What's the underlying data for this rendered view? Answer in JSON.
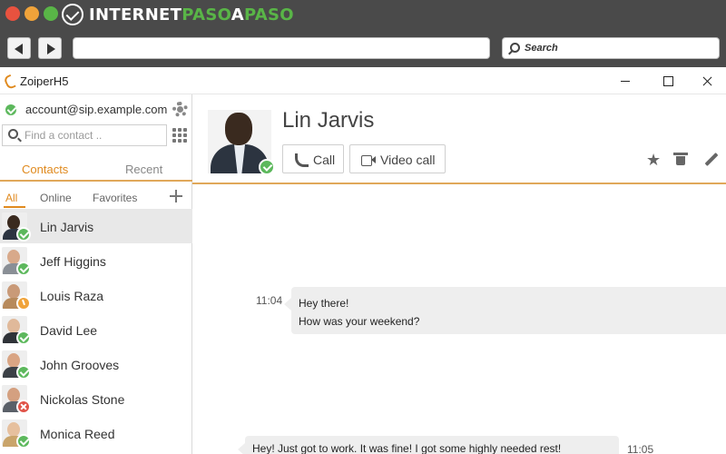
{
  "chrome": {
    "brand_part1": "INTERNET",
    "brand_part2": "PASO",
    "brand_part3": "A",
    "brand_part4": "PASO",
    "search_label": "Search",
    "traffic_colors": [
      "#e8523f",
      "#f0a33a",
      "#59b547"
    ]
  },
  "app": {
    "title": "ZoiperH5",
    "accent_color": "#e08a1e"
  },
  "sidebar": {
    "account": "account@sip.example.com",
    "find_placeholder": "Find a contact ..",
    "tabs": [
      {
        "label": "Contacts",
        "active": true
      },
      {
        "label": "Recent",
        "active": false
      }
    ],
    "filters": [
      {
        "label": "All",
        "active": true
      },
      {
        "label": "Online",
        "active": false
      },
      {
        "label": "Favorites",
        "active": false
      }
    ],
    "contacts": [
      {
        "name": "Lin Jarvis",
        "status": "online",
        "selected": true
      },
      {
        "name": "Jeff Higgins",
        "status": "online",
        "selected": false
      },
      {
        "name": "Louis Raza",
        "status": "away",
        "selected": false
      },
      {
        "name": "David Lee",
        "status": "online",
        "selected": false
      },
      {
        "name": "John Grooves",
        "status": "online",
        "selected": false
      },
      {
        "name": "Nickolas Stone",
        "status": "busy",
        "selected": false
      },
      {
        "name": "Monica Reed",
        "status": "online",
        "selected": false
      }
    ]
  },
  "main": {
    "contact_name": "Lin Jarvis",
    "call_label": "Call",
    "video_call_label": "Video call",
    "messages": [
      {
        "time": "11:04",
        "lines": [
          "Hey there!",
          "How was your weekend?"
        ]
      },
      {
        "time": "11:05",
        "lines": [
          "Hey! Just got to work. It was fine! I got some highly needed rest!"
        ]
      }
    ]
  }
}
